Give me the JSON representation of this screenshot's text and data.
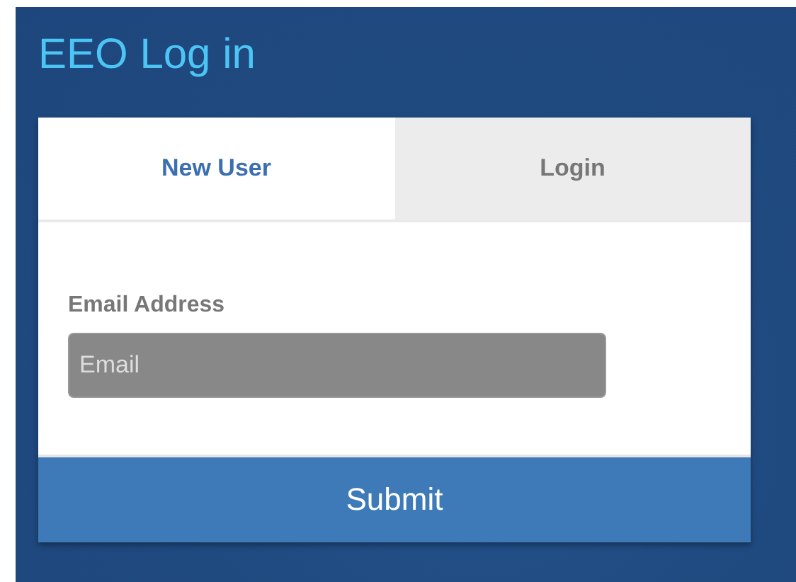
{
  "title": "EEO Log in",
  "tabs": [
    {
      "label": "New User",
      "selected": true
    },
    {
      "label": "Login",
      "selected": false
    }
  ],
  "form": {
    "label": "Email Address",
    "field": {
      "placeholder": "Email"
    }
  },
  "submit": "Submit"
}
